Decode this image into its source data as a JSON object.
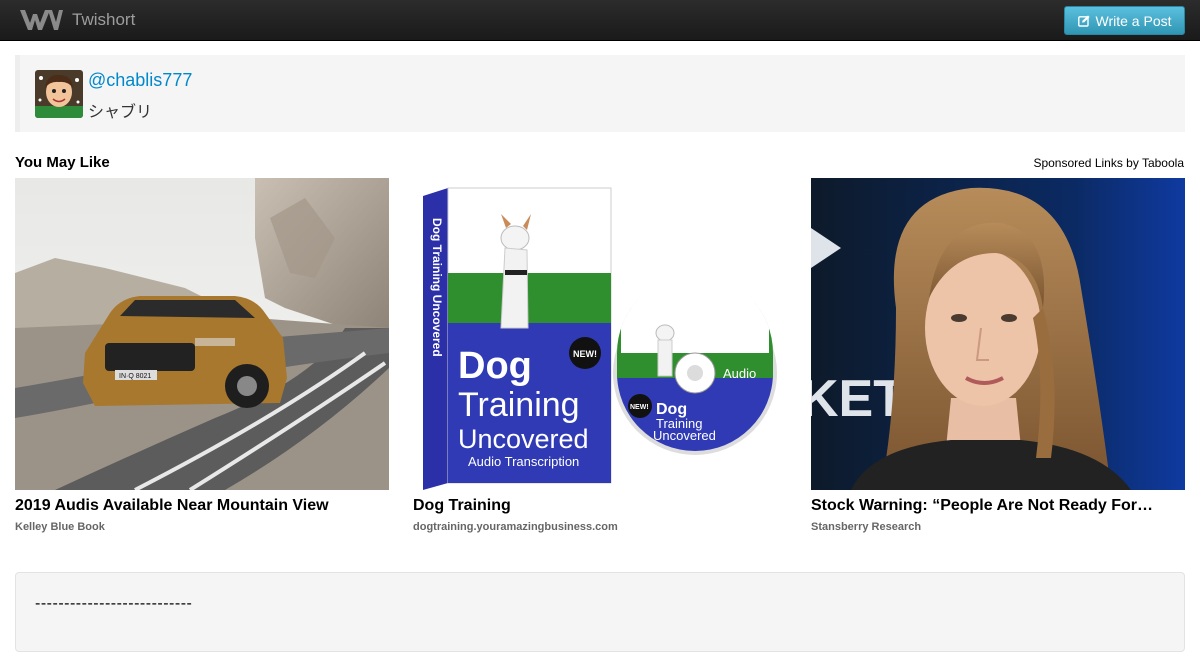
{
  "navbar": {
    "brand": "Twishort",
    "logo_icon": "twishort-logo-icon",
    "write_button": "Write a Post",
    "write_icon": "edit-icon"
  },
  "profile": {
    "handle": "@chablis777",
    "display_name": "シャブリ"
  },
  "recommendations": {
    "title": "You May Like",
    "sponsored": "Sponsored Links by Taboola",
    "items": [
      {
        "headline": "2019 Audis Available Near Mountain View",
        "source": "Kelley Blue Book",
        "plate": "IN·Q 8021"
      },
      {
        "headline": "Dog Training",
        "source": "dogtraining.youramazingbusiness.com",
        "book_title_1": "Dog",
        "book_title_2": "Training",
        "book_title_3": "Uncovered",
        "book_subtitle": "Audio Transcription",
        "book_spine": "Dog Training Uncovered",
        "book_badge": "NEW!",
        "cd_label": "Audio",
        "cd_badge": "NEW!",
        "cd_title_1": "Dog",
        "cd_title_2": "Training",
        "cd_title_3": "Uncovered"
      },
      {
        "headline": "Stock Warning: “People Are Not Ready For…",
        "source": "Stansberry Research",
        "bg_text": "KET"
      }
    ]
  },
  "post": {
    "text": "---------------------------"
  },
  "colors": {
    "navbar": "#1f1f1f",
    "button": "#49afcd",
    "link": "#0088cc"
  }
}
